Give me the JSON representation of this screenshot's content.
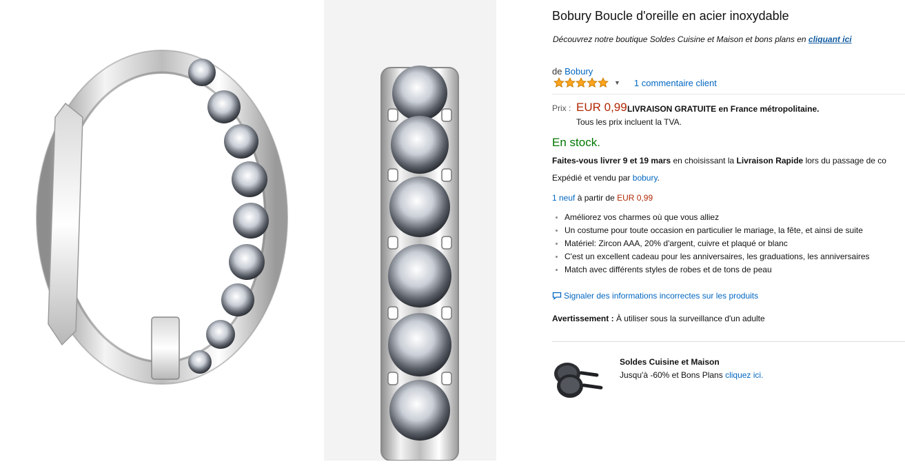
{
  "product": {
    "title": "Bobury Boucle d'oreille en acier inoxydable",
    "promo_text": "Découvrez notre boutique Soldes Cuisine et Maison et bons plans en",
    "promo_link": "cliquant ici",
    "by_prefix": "de",
    "brand": "Bobury",
    "rating_stars": 5,
    "reviews_link": "1 commentaire client"
  },
  "pricing": {
    "label": "Prix :",
    "price": "EUR 0,99",
    "shipping": "LIVRAISON GRATUITE en France métropolitaine.",
    "tax_note": "Tous les prix incluent la TVA."
  },
  "availability": {
    "stock": "En stock.",
    "delivery_a": "Faites-vous livrer",
    "delivery_dates": "9 et 19 mars",
    "delivery_b": "en choisissant la",
    "delivery_option": "Livraison Rapide",
    "delivery_c": "lors du passage de co",
    "seller_prefix": "Expédié et vendu par",
    "seller": "bobury",
    "seller_suffix": ".",
    "offers_link": "1 neuf",
    "offers_mid": "à partir de",
    "offers_price": "EUR 0,99"
  },
  "features": [
    "Améliorez vos charmes où que vous alliez",
    "Un costume pour toute occasion en particulier le mariage, la fête, et ainsi de suite",
    "Matériel: Zircon AAA, 20% d'argent, cuivre et plaqué or blanc",
    "C'est un excellent cadeau pour les anniversaires, les graduations, les anniversaires",
    "Match avec différents styles de robes et de tons de peau"
  ],
  "report_link": "Signaler des informations incorrectes sur les produits",
  "warning": {
    "label": "Avertissement :",
    "text": "À utiliser sous la surveillance d'un adulte"
  },
  "ad": {
    "title": "Soldes Cuisine et Maison",
    "text": "Jusqu'à -60% et Bons Plans",
    "link": "cliquez ici."
  },
  "icons": {
    "star": "star-icon",
    "dropdown": "caret-down-icon",
    "report": "speech-bubble-icon",
    "ad_image": "frying-pans-icon"
  },
  "colors": {
    "price": "#b12704",
    "stock": "#007600",
    "link": "#0066c0",
    "star": "#ffa41c"
  }
}
